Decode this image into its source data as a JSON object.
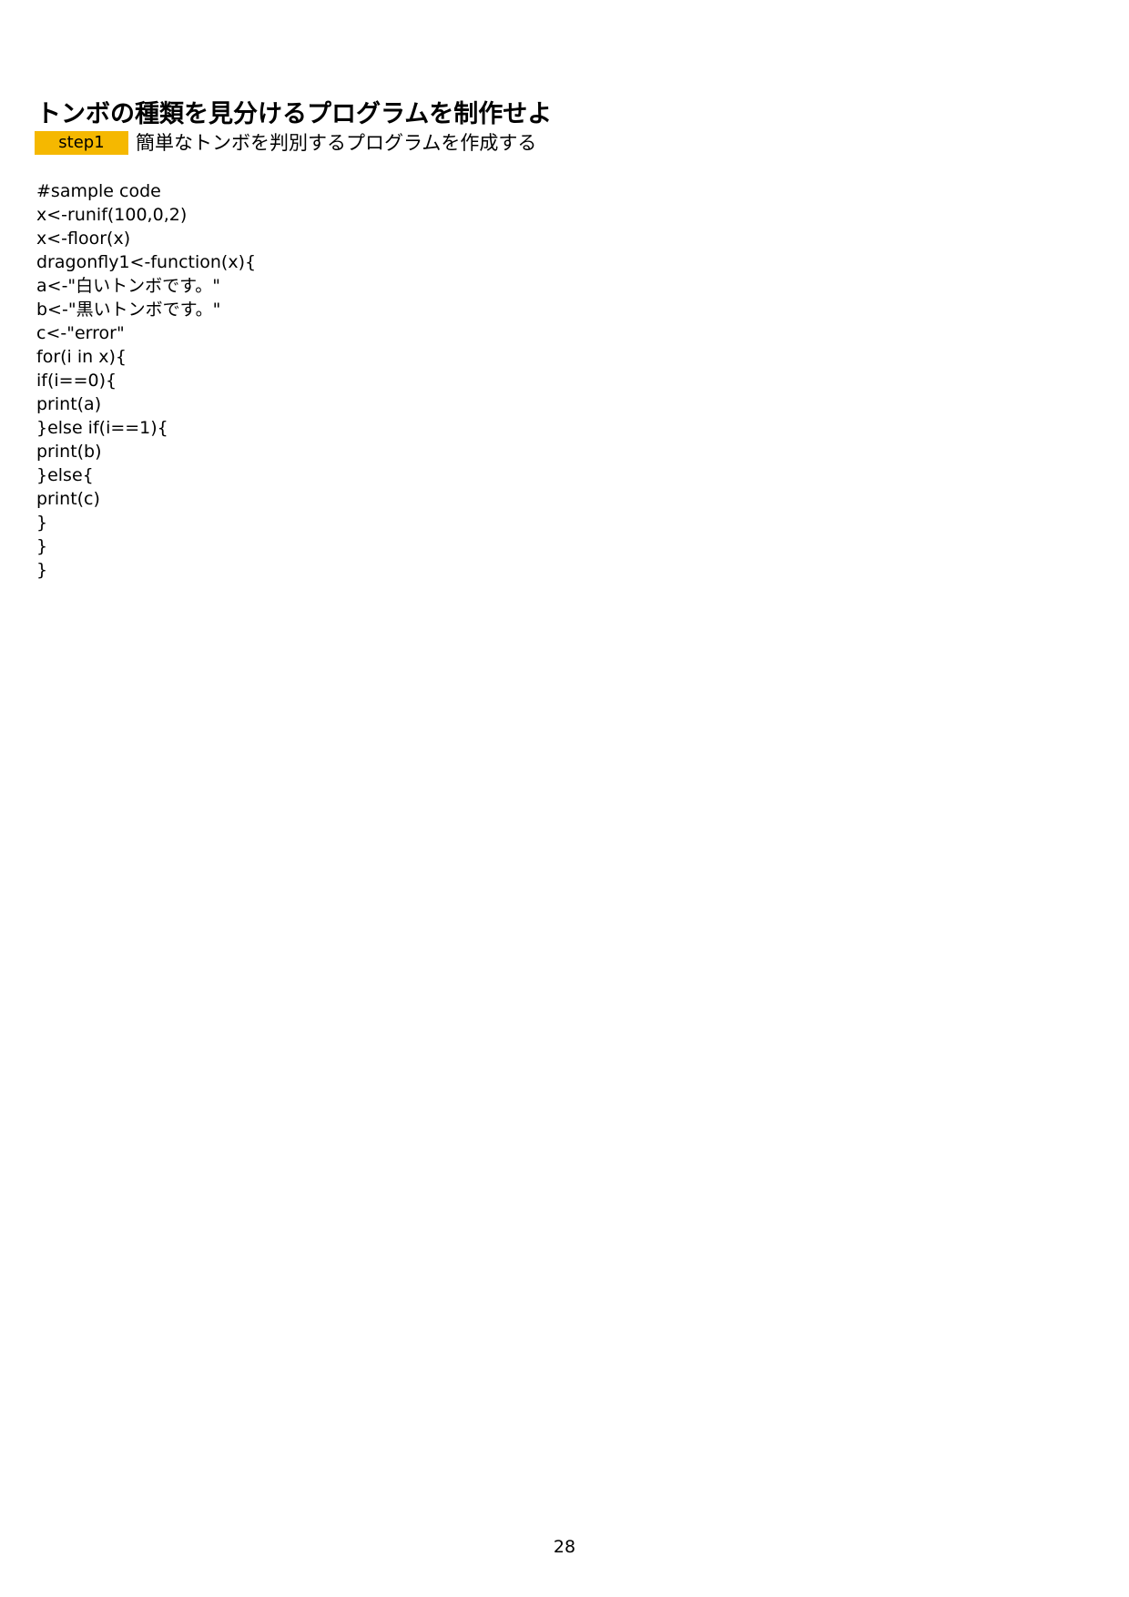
{
  "title": "トンボの種類を見分けるプログラムを制作せよ",
  "step": {
    "badge": "step1",
    "description": "簡単なトンボを判別するプログラムを作成する",
    "badge_color": "#f5b800"
  },
  "code_lines": [
    "#sample code",
    "x<-runif(100,0,2)",
    "x<-floor(x)",
    "dragonfly1<-function(x){",
    "a<-\"白いトンボです。\"",
    "b<-\"黒いトンボです。\"",
    "c<-\"error\"",
    "for(i in x){",
    "if(i==0){",
    "print(a)",
    "}else if(i==1){",
    "print(b)",
    "}else{",
    "print(c)",
    "}",
    "}",
    "}"
  ],
  "page_number": "28"
}
